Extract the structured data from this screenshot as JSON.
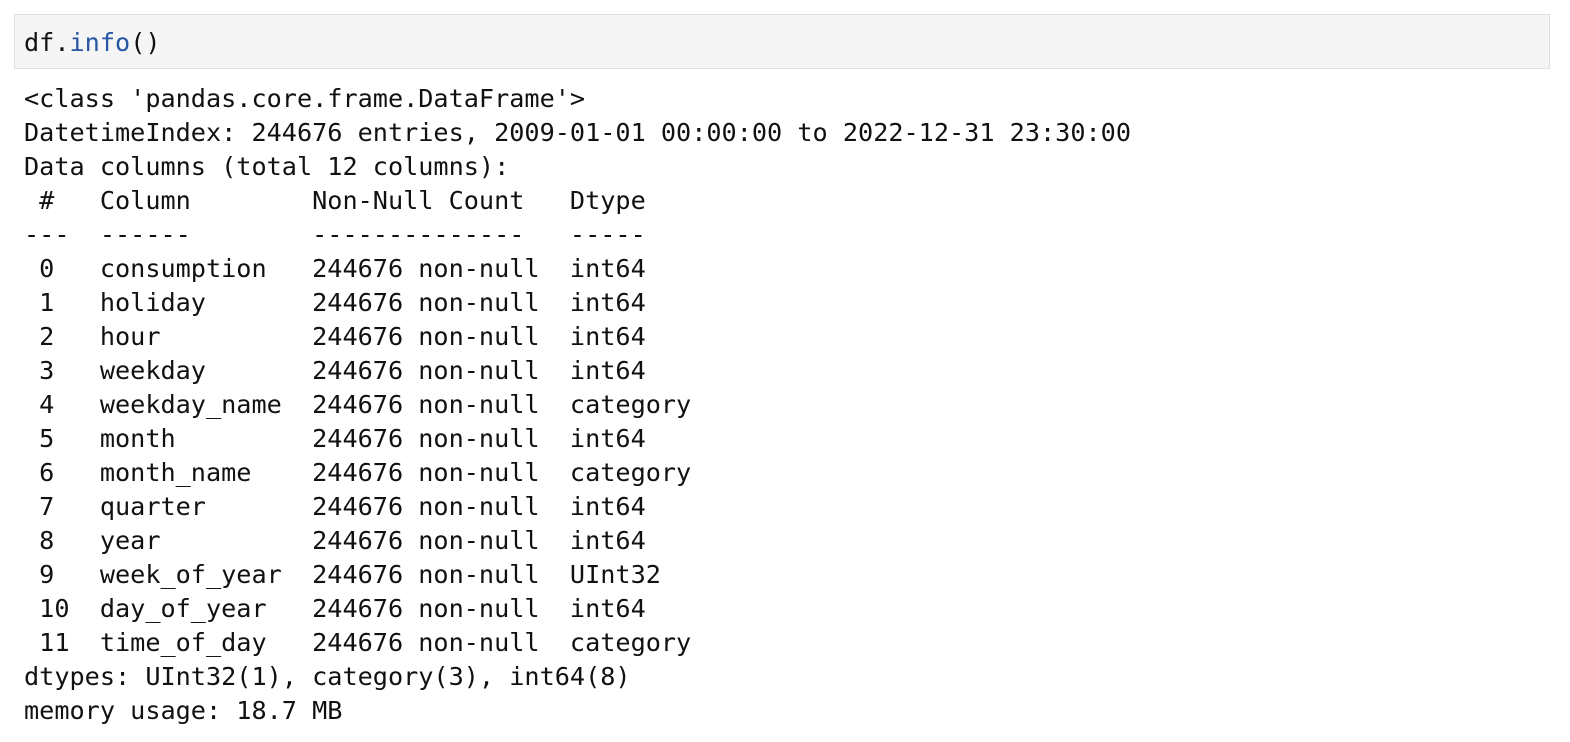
{
  "cell": {
    "input": {
      "object": "df",
      "dot": ".",
      "method": "info",
      "call": "()"
    },
    "output": {
      "class_line": "<class 'pandas.core.frame.DataFrame'>",
      "index_line": "DatetimeIndex: 244676 entries, 2009-01-01 00:00:00 to 2022-12-31 23:30:00",
      "columns_summary": "Data columns (total 12 columns):",
      "table_header": " #   Column        Non-Null Count   Dtype   ",
      "table_separator": "---  ------        --------------   -----   ",
      "rows": [
        " 0   consumption   244676 non-null  int64   ",
        " 1   holiday       244676 non-null  int64   ",
        " 2   hour          244676 non-null  int64   ",
        " 3   weekday       244676 non-null  int64   ",
        " 4   weekday_name  244676 non-null  category",
        " 5   month         244676 non-null  int64   ",
        " 6   month_name    244676 non-null  category",
        " 7   quarter       244676 non-null  int64   ",
        " 8   year          244676 non-null  int64   ",
        " 9   week_of_year  244676 non-null  UInt32  ",
        " 10  day_of_year   244676 non-null  int64   ",
        " 11  time_of_day   244676 non-null  category"
      ],
      "dtypes_line": "dtypes: UInt32(1), category(3), int64(8)",
      "memory_line": "memory usage: 18.7 MB"
    }
  },
  "colors": {
    "method_token": "#2757a4",
    "code_cell_background": "#f5f5f5",
    "code_cell_border": "#e0e0e0",
    "text": "#111111"
  }
}
